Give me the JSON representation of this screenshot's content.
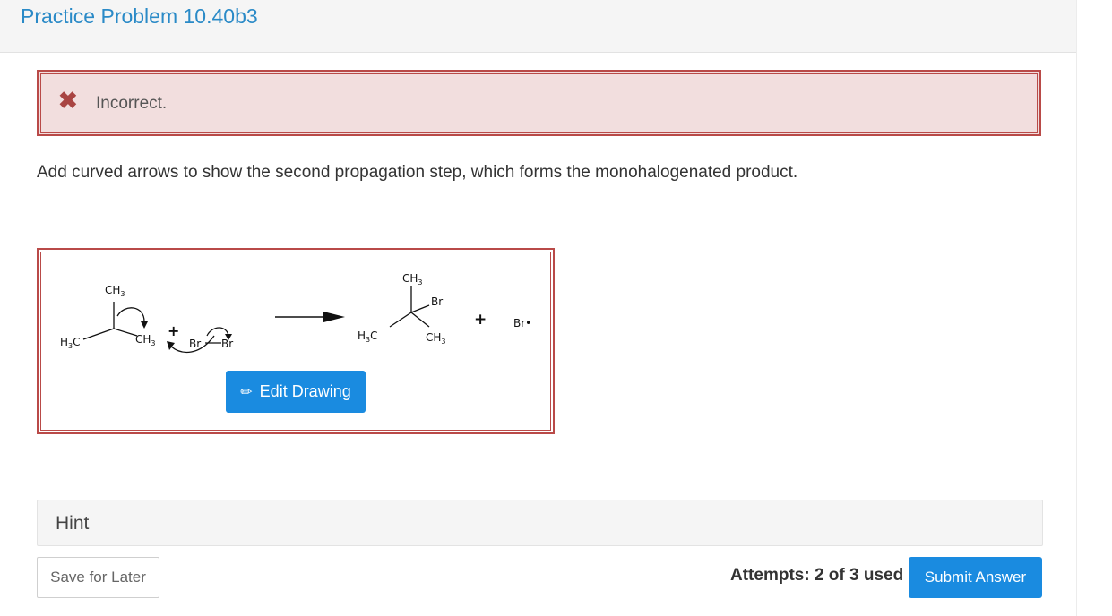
{
  "header": {
    "title": "Practice Problem 10.40b3"
  },
  "alert": {
    "icon": "close-icon",
    "message": "Incorrect."
  },
  "instructions": "Add curved arrows to show the second propagation step, which forms the monohalogenated product.",
  "drawing": {
    "edit_label": "Edit Drawing",
    "reactant": {
      "top_label": "CH",
      "top_sub": "3",
      "left_label": "H",
      "left_sub": "3",
      "left_tail": "C",
      "right_label": "CH",
      "right_sub": "3",
      "radical_plus": "+",
      "br1": "Br",
      "br2": "Br"
    },
    "product": {
      "top_label": "CH",
      "top_sub": "3",
      "br_label": "Br",
      "left_label": "H",
      "left_sub": "3",
      "left_tail": "C",
      "bottom_label": "CH",
      "bottom_sub": "3",
      "plus": "+",
      "br_radical": "Br•"
    }
  },
  "hint": {
    "label": "Hint"
  },
  "footer": {
    "save_label": "Save for Later",
    "attempts": "Attempts: 2 of 3 used",
    "submit_label": "Submit Answer"
  },
  "colors": {
    "accent": "#1a8be0",
    "title": "#2a8ac7",
    "error_border": "#b94a48",
    "error_bg": "#f2dede"
  }
}
